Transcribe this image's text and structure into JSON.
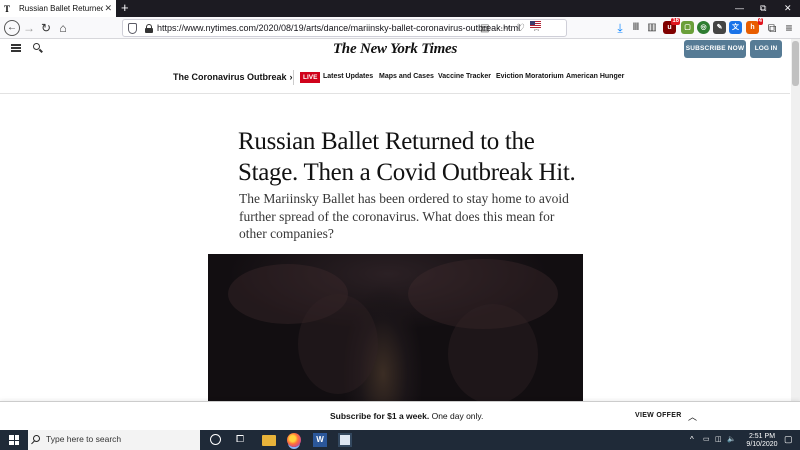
{
  "browser": {
    "tab_title": "Russian Ballet Returned to the",
    "tab_favicon": "T",
    "new_tab": "+",
    "url": "https://www.nytimes.com/2020/08/19/arts/dance/mariinsky-ballet-coronavirus-outbreak.html",
    "window_controls": [
      "—",
      "⧉",
      "✕"
    ],
    "extension_badges": {
      "ublock": "16",
      "honey": "4"
    }
  },
  "header": {
    "masthead": "The New York Times",
    "subscribe_label": "SUBSCRIBE NOW",
    "login_label": "LOG IN"
  },
  "subnav": {
    "section_title": "The Coronavirus Outbreak",
    "section_chevron": "›",
    "live_badge": "LIVE",
    "links": [
      "Latest Updates",
      "Maps and Cases",
      "Vaccine Tracker",
      "Eviction Moratorium",
      "American Hunger"
    ]
  },
  "article": {
    "headline": "Russian Ballet Returned to the Stage. Then a Covid Outbreak Hit.",
    "summary": "The Mariinsky Ballet has been ordered to stay home to avoid further spread of the coronavirus. What does this mean for other companies?"
  },
  "promo": {
    "offer_bold": "Subscribe for $1 a week.",
    "offer_rest": " One day only.",
    "cta": "VIEW OFFER",
    "caret": "︿"
  },
  "taskbar": {
    "search_placeholder": "Type here to search",
    "time": "2:51 PM",
    "date": "9/10/2020",
    "tray_caret": "^"
  },
  "colors": {
    "subscribe_button": "#567b95",
    "live_badge": "#d0021b",
    "taskbar": "#1f2a38"
  }
}
